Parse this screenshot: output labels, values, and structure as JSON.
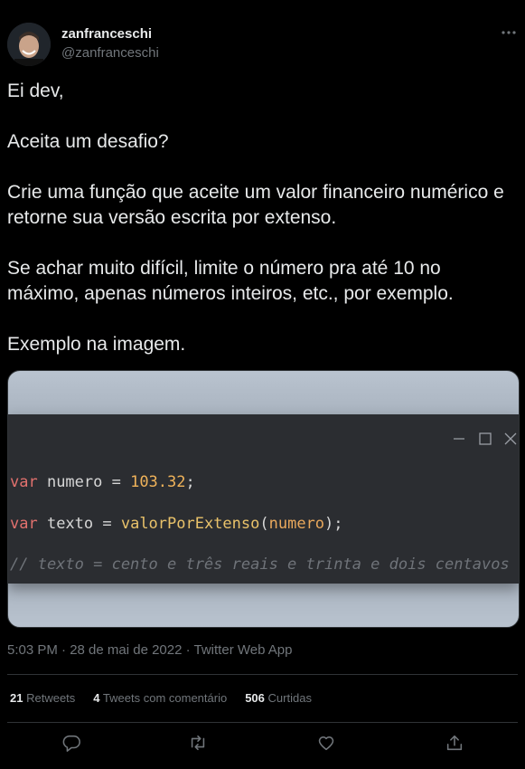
{
  "author": {
    "display_name": "zanfranceschi",
    "handle": "@zanfranceschi"
  },
  "tweet": {
    "paragraphs": [
      "Ei dev,",
      "Aceita um desafio?",
      "Crie uma função que aceite um valor financeiro numérico e retorne sua versão escrita por extenso.",
      "Se achar muito difícil, limite o número pra até 10 no máximo, apenas números inteiros, etc., por exemplo.",
      "Exemplo na imagem."
    ]
  },
  "code": {
    "line1": {
      "kw": "var",
      "name": " numero = ",
      "value": "103.32",
      "end": ";"
    },
    "line2": {
      "kw": "var",
      "name": " texto = ",
      "fn": "valorPorExtenso",
      "open": "(",
      "arg": "numero",
      "close": ");"
    },
    "line3": "// texto = cento e três reais e trinta e dois centavos"
  },
  "meta": "5:03 PM · 28 de mai de 2022 · Twitter Web App",
  "stats": {
    "retweets_count": "21",
    "retweets_label": "Retweets",
    "quotes_count": "4",
    "quotes_label": "Tweets com comentário",
    "likes_count": "506",
    "likes_label": "Curtidas"
  },
  "icons": {
    "more": "more-icon",
    "reply": "reply-icon",
    "retweet": "retweet-icon",
    "like": "heart-icon",
    "share": "share-icon"
  }
}
